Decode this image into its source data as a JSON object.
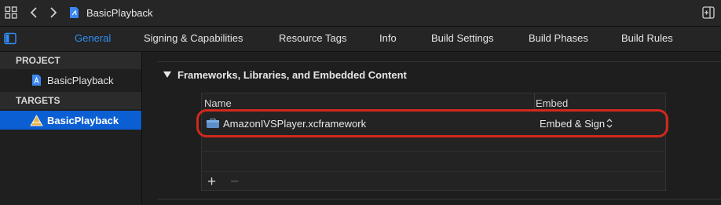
{
  "toolbar": {
    "back_glyph": "‹",
    "forward_glyph": "›",
    "file_title": "BasicPlayback",
    "icons": [
      "grid-icon",
      "back-chevron-icon",
      "forward-chevron-icon",
      "swift-file-icon",
      "inspector-panel-icon"
    ]
  },
  "tabs": [
    {
      "label": "General",
      "active": true
    },
    {
      "label": "Signing & Capabilities",
      "active": false
    },
    {
      "label": "Resource Tags",
      "active": false
    },
    {
      "label": "Info",
      "active": false
    },
    {
      "label": "Build Settings",
      "active": false
    },
    {
      "label": "Build Phases",
      "active": false
    },
    {
      "label": "Build Rules",
      "active": false
    }
  ],
  "sidebar": {
    "project_header": "PROJECT",
    "project_item": "BasicPlayback",
    "targets_header": "TARGETS",
    "target_item": "BasicPlayback"
  },
  "frameworks": {
    "section_title": "Frameworks, Libraries, and Embedded Content",
    "columns": {
      "name": "Name",
      "embed": "Embed"
    },
    "rows": [
      {
        "name": "AmazonIVSPlayer.xcframework",
        "embed": "Embed & Sign"
      }
    ],
    "add_label": "+",
    "remove_label": "−"
  },
  "colors": {
    "accent": "#2f8ef5",
    "selection": "#0b5fd3",
    "highlight_outline": "#d1281c",
    "background": "#1e1e1e"
  }
}
